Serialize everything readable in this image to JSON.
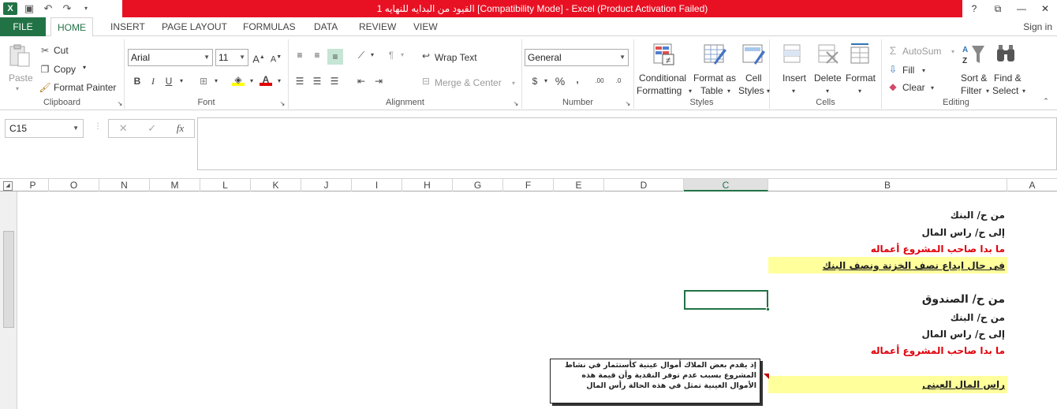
{
  "window": {
    "title": "القيود من البدايه للنهايه  1  [Compatibility Mode] -  Excel (Product Activation Failed)",
    "help": "?",
    "restore": "⧉",
    "minimize": "—",
    "close": "✕"
  },
  "tabs": [
    {
      "label": "FILE"
    },
    {
      "label": "HOME"
    },
    {
      "label": "INSERT"
    },
    {
      "label": "PAGE LAYOUT"
    },
    {
      "label": "FORMULAS"
    },
    {
      "label": "DATA"
    },
    {
      "label": "REVIEW"
    },
    {
      "label": "VIEW"
    }
  ],
  "sign_in": "Sign in",
  "ribbon": {
    "clipboard": {
      "label": "Clipboard",
      "paste": "Paste",
      "cut": "Cut",
      "copy": "Copy",
      "format_painter": "Format Painter"
    },
    "font": {
      "label": "Font",
      "name": "Arial",
      "size": "11"
    },
    "alignment": {
      "label": "Alignment",
      "wrap_text": "Wrap Text",
      "merge_center": "Merge & Center"
    },
    "number": {
      "label": "Number",
      "format": "General"
    },
    "styles": {
      "label": "Styles",
      "conditional_1": "Conditional",
      "conditional_2": "Formatting",
      "format_table_1": "Format as",
      "format_table_2": "Table",
      "cell_styles_1": "Cell",
      "cell_styles_2": "Styles"
    },
    "cells": {
      "label": "Cells",
      "insert": "Insert",
      "delete": "Delete",
      "format": "Format"
    },
    "editing": {
      "label": "Editing",
      "autosum": "AutoSum",
      "fill": "Fill",
      "clear": "Clear",
      "sort_1": "Sort &",
      "sort_2": "Filter",
      "find_1": "Find &",
      "find_2": "Select"
    }
  },
  "formula_bar": {
    "name_box": "C15",
    "formula": ""
  },
  "columns": [
    "P",
    "O",
    "N",
    "M",
    "L",
    "K",
    "J",
    "I",
    "H",
    "G",
    "F",
    "E",
    "D",
    "C",
    "B",
    "A"
  ],
  "cells": {
    "r1": "من ح/ البنك",
    "r2": "إلى ح/ راس المال",
    "r3": "ما بدا صاحب المشروع أعماله",
    "r4": "فى حال ايداع نصف الخزنة ونصف البنك",
    "r5": "من ح/ الصندوق",
    "r6": "من ح/ البنك",
    "r7": "إلى ح/ راس المال",
    "r8": "ما بدا صاحب المشروع أعماله",
    "r9": "راس المال العينى"
  },
  "comment": "إذ يقدم بعض الملاك أموال عينية كأستثمار في نشاط المشروع بسبب عدم توفر النقدية  وأن قيمة هذه الأموال العينية تمثل في هذه الحالة رأس المال",
  "colors": {
    "accent": "#217346",
    "title_bar": "#e81123",
    "highlight": "#ffff9c",
    "red_text": "#e0000b"
  }
}
